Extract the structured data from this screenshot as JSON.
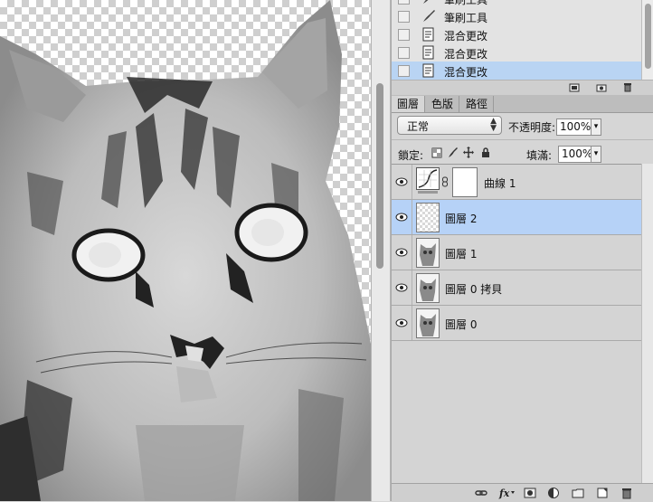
{
  "history": {
    "items": [
      {
        "label": "筆刷工具",
        "icon": "brush-icon",
        "selected": false
      },
      {
        "label": "筆刷工具",
        "icon": "brush-icon",
        "selected": false
      },
      {
        "label": "混合更改",
        "icon": "history-state-icon",
        "selected": false
      },
      {
        "label": "混合更改",
        "icon": "history-state-icon",
        "selected": false
      },
      {
        "label": "混合更改",
        "icon": "history-state-icon",
        "selected": true
      }
    ]
  },
  "tabs": [
    {
      "label": "圖層",
      "active": true
    },
    {
      "label": "色版",
      "active": false
    },
    {
      "label": "路徑",
      "active": false
    }
  ],
  "layers_panel": {
    "blend_mode": "正常",
    "opacity_label": "不透明度:",
    "opacity_value": "100%",
    "lock_label": "鎖定:",
    "fill_label": "填滿:",
    "fill_value": "100%"
  },
  "layers": [
    {
      "name": "曲線 1",
      "type": "adjustment",
      "visible": true,
      "selected": false
    },
    {
      "name": "圖層 2",
      "type": "empty",
      "visible": true,
      "selected": true
    },
    {
      "name": "圖層 1",
      "type": "image",
      "visible": true,
      "selected": false
    },
    {
      "name": "圖層 0 拷貝",
      "type": "image",
      "visible": true,
      "selected": false
    },
    {
      "name": "圖層 0",
      "type": "image",
      "visible": true,
      "selected": false
    }
  ],
  "footer_icons": [
    "link-icon",
    "fx-icon",
    "mask-icon",
    "adjustment-icon",
    "group-folder-icon",
    "new-layer-icon",
    "trash-icon"
  ],
  "colors": {
    "selection": "#b6d2f7",
    "panel": "#d6d6d6"
  }
}
